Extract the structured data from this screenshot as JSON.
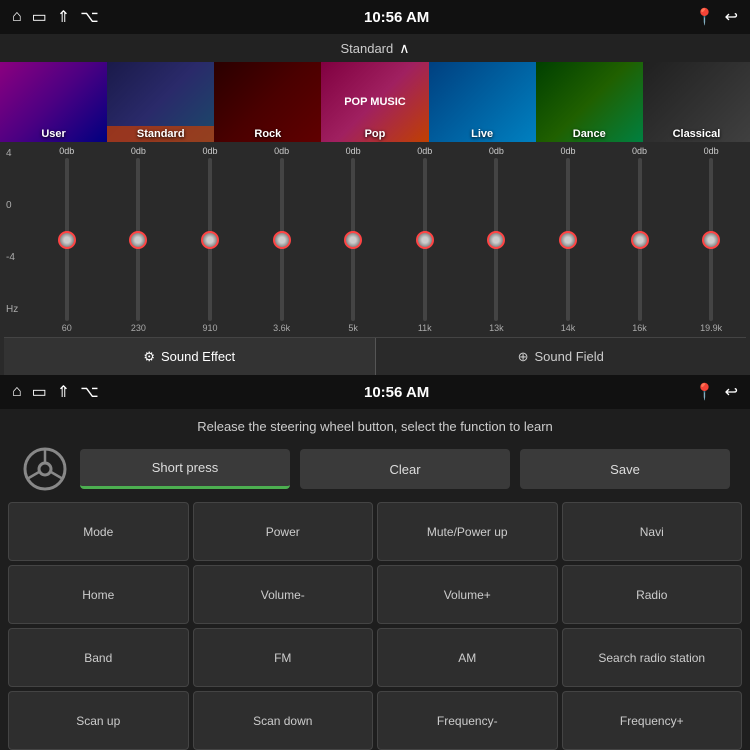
{
  "topPanel": {
    "statusBar": {
      "time": "10:56 AM",
      "icons": [
        "⌂",
        "▭",
        "⇑",
        "⌥"
      ],
      "rightIcons": [
        "📍",
        "↩"
      ]
    },
    "genreBar": {
      "label": "Standard",
      "chevron": "∧"
    },
    "genres": [
      {
        "id": "user",
        "label": "User",
        "active": false
      },
      {
        "id": "standard",
        "label": "Standard",
        "active": true
      },
      {
        "id": "rock",
        "label": "Rock",
        "active": false
      },
      {
        "id": "pop",
        "label": "Pop",
        "active": false
      },
      {
        "id": "live",
        "label": "Live",
        "active": false
      },
      {
        "id": "dance",
        "label": "Dance",
        "active": false
      },
      {
        "id": "classical",
        "label": "Classical",
        "active": false
      }
    ],
    "eq": {
      "topLabels": [
        "0db",
        "0db",
        "0db",
        "0db",
        "0db",
        "0db",
        "0db",
        "0db",
        "0db",
        "0db"
      ],
      "leftLabels": [
        "4",
        "0",
        "-4"
      ],
      "leftUnit": "Hz",
      "bands": [
        "60",
        "230",
        "910",
        "3.6k",
        "5k",
        "11k",
        "13k",
        "14k",
        "16k",
        "19.9k"
      ]
    },
    "tabs": [
      {
        "id": "sound-effect",
        "label": "Sound Effect",
        "active": true
      },
      {
        "id": "sound-field",
        "label": "Sound Field",
        "active": false
      }
    ]
  },
  "bottomPanel": {
    "statusBar": {
      "time": "10:56 AM",
      "icons": [
        "⌂",
        "▭",
        "⇑",
        "⌥"
      ],
      "rightIcons": [
        "📍",
        "↩"
      ]
    },
    "instruction": "Release the steering wheel button, select the function to learn",
    "controls": {
      "shortPress": "Short press",
      "clear": "Clear",
      "save": "Save"
    },
    "functions": [
      "Mode",
      "Power",
      "Mute/Power up",
      "Navi",
      "Home",
      "Volume-",
      "Volume+",
      "Radio",
      "Band",
      "FM",
      "AM",
      "Search radio station",
      "Scan up",
      "Scan down",
      "Frequency-",
      "Frequency+"
    ]
  }
}
